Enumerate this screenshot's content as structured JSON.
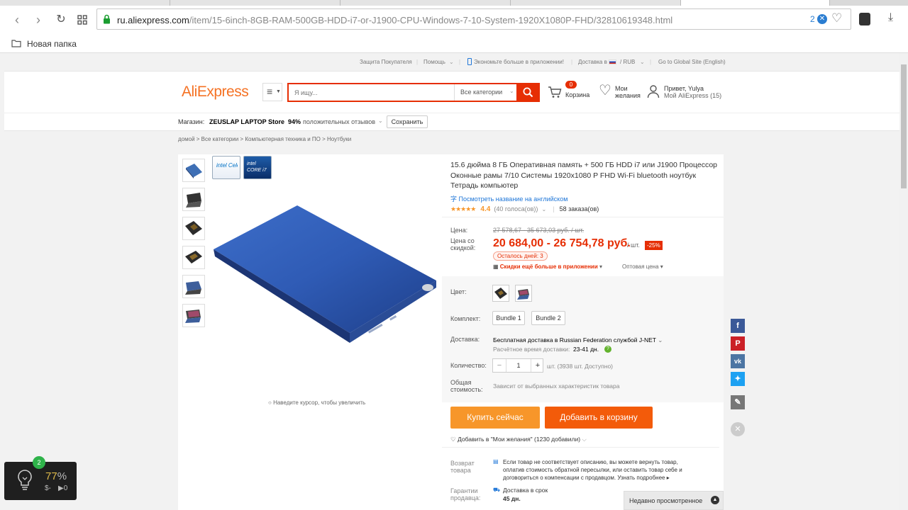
{
  "browser": {
    "url_domain": "ru.aliexpress.com",
    "url_path": "/item/15-6inch-8GB-RAM-500GB-HDD-i7-or-J1900-CPU-Windows-7-10-System-1920X1080P-FHD/32810619348.html",
    "adblock_count": "2",
    "bookmark_label": "Новая папка"
  },
  "topnav": {
    "buyer_protection": "Защита Покупателя",
    "help": "Помощь",
    "app_promo": "Экономьте больше в приложении!",
    "ship_to": "Доставка в",
    "currency": "/ RUB",
    "global_site": "Go to Global Site (English)"
  },
  "header": {
    "logo": "AliExpress",
    "search_placeholder": "Я ищу...",
    "all_categories": "Все категории",
    "cart_count": "0",
    "cart_label": "Корзина",
    "wishlist_line1": "Мои",
    "wishlist_line2": "желания",
    "greeting": "Привет, Yulya",
    "my_account": "Мой AliExpress (15)"
  },
  "store": {
    "label": "Магазин:",
    "name": "ZEUSLAP LAPTOP Store",
    "feedback_percent": "94%",
    "feedback_text": "положительных отзывов",
    "save_button": "Сохранить"
  },
  "breadcrumbs": "домой > Все категории > Компьютерная техника и ПО > Ноутбуки",
  "product": {
    "badge_intel_celeron": "intel Celeron",
    "badge_intel_core": "intel CORE i7",
    "zoom_hint": "Наведите курсор, чтобы увеличить",
    "title": "15.6 дюйма 8 ГБ Оперативная память + 500 ГБ HDD i7 или J1900 Процессор Оконные рамы 7/10 Системы 1920x1080 P FHD Wi-Fi bluetooth ноутбук Тетрадь компьютер",
    "translate_link": "Посмотреть название на английском",
    "rating": "4.4",
    "votes": "(40 голоса(ов))",
    "orders": "58 заказа(ов)",
    "price_label": "Цена:",
    "old_price": "27 578,67 - 35 673,03 руб. / шт.",
    "discount_label_1": "Цена со",
    "discount_label_2": "скидкой:",
    "price": "20 684,00 - 26 754,78 руб.",
    "price_unit": "/ шт.",
    "discount_badge": "-25%",
    "days_left": "Осталось дней: 3",
    "app_discount": "Скидки ещё больше в приложении",
    "wholesale": "Оптовая цена",
    "color_label": "Цвет:",
    "kit_label": "Комплект:",
    "bundle_1": "Bundle 1",
    "bundle_2": "Bundle 2",
    "delivery_label": "Доставка:",
    "delivery_text": "Бесплатная доставка в Russian Federation службой J-NET",
    "delivery_time_label": "Расчётное время доставки:",
    "delivery_time": "23-41 дн.",
    "quantity_label": "Количество:",
    "quantity_value": "1",
    "quantity_note": "шт. (3938 шт. Доступно)",
    "total_label_1": "Общая",
    "total_label_2": "стоимость:",
    "total_note": "Зависит от выбранных характеристик товара",
    "buy_now": "Купить сейчас",
    "add_to_cart": "Добавить в корзину",
    "add_wishlist": "Добавить в \"Мои желания\" (1230 добавили)",
    "return_label_1": "Возврат",
    "return_label_2": "товара",
    "return_text_1": "Если товар не соответствует описанию, вы можете вернуть товар,",
    "return_text_2": "оплатив стоимость обратной пересылки, или оставить товар себе и",
    "return_text_3": "договориться о компенсации с продавцом. Узнать подробнее",
    "guarantee_label_1": "Гарантии",
    "guarantee_label_2": "продавца:",
    "guarantee_title": "Доставка в срок",
    "guarantee_days": "45 дн."
  },
  "recently_viewed": "Недавно просмотренное",
  "widget": {
    "badge": "2",
    "percent": "77",
    "percent_sign": "%",
    "left_text": "$-",
    "right_text": "▶0"
  },
  "colors": {
    "accent_red": "#e62e04",
    "buy_orange": "#f7962a",
    "cart_orange": "#f35b0a",
    "link_blue": "#2077d8"
  }
}
